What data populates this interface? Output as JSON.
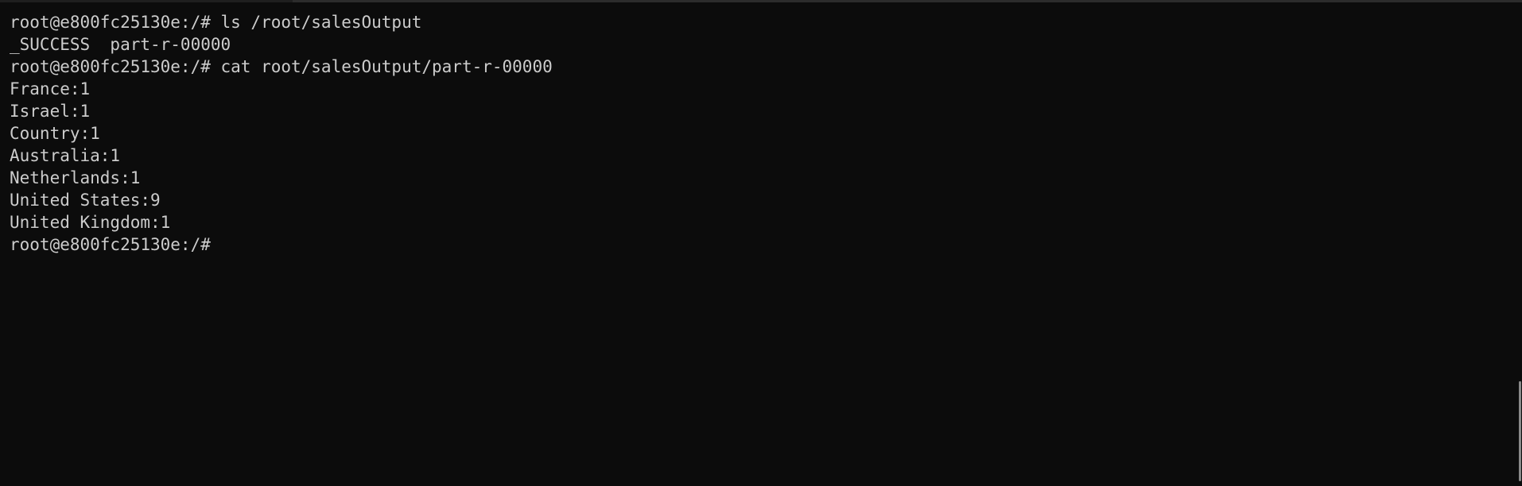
{
  "terminal": {
    "lines": [
      {
        "kind": "prompt",
        "text": "root@e800fc25130e:/# ls /root/salesOutput"
      },
      {
        "kind": "output",
        "text": "_SUCCESS  part-r-00000"
      },
      {
        "kind": "prompt",
        "text": "root@e800fc25130e:/# cat root/salesOutput/part-r-00000"
      },
      {
        "kind": "output",
        "text": "France:1"
      },
      {
        "kind": "output",
        "text": "Israel:1"
      },
      {
        "kind": "output",
        "text": "Country:1"
      },
      {
        "kind": "output",
        "text": "Australia:1"
      },
      {
        "kind": "output",
        "text": "Netherlands:1"
      },
      {
        "kind": "output",
        "text": "United States:9"
      },
      {
        "kind": "output",
        "text": "United Kingdom:1"
      }
    ],
    "current_prompt": "root@e800fc25130e:/# "
  },
  "colors": {
    "background": "#0c0c0c",
    "foreground": "#cccccc",
    "scrollbar": "#8a8a8a"
  }
}
